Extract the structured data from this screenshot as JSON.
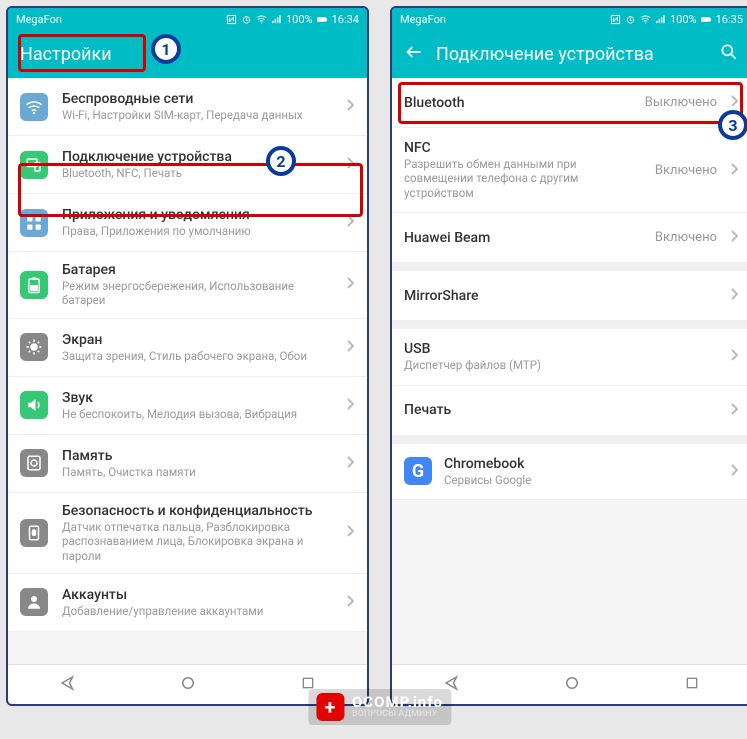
{
  "status": {
    "carrier": "MegaFon",
    "battery": "100%",
    "time1": "16:34",
    "time2": "16:35"
  },
  "left": {
    "title": "Настройки",
    "items": [
      {
        "title": "Беспроводные сети",
        "sub": "Wi-Fi, Настройки SIM-карт, Передача данных",
        "icon": "wifi",
        "col": "#6aa9d4"
      },
      {
        "title": "Подключение устройства",
        "sub": "Bluetooth, NFC, Печать",
        "icon": "devcon",
        "col": "#37c876"
      },
      {
        "title": "Приложения и уведомления",
        "sub": "Права, Приложения по умолчанию",
        "icon": "apps",
        "col": "#6aa9d4"
      },
      {
        "title": "Батарея",
        "sub": "Режим энергосбережения, Использование батареи",
        "icon": "battery",
        "col": "#37c876"
      },
      {
        "title": "Экран",
        "sub": "Защита зрения, Стиль рабочего экрана, Обои",
        "icon": "display",
        "col": "#888"
      },
      {
        "title": "Звук",
        "sub": "Не беспокоить, Мелодия вызова, Вибрация",
        "icon": "sound",
        "col": "#37c876"
      },
      {
        "title": "Память",
        "sub": "Память, Очистка памяти",
        "icon": "storage",
        "col": "#888"
      },
      {
        "title": "Безопасность и конфиденциальность",
        "sub": "Датчик отпечатка пальца, Разблокировка распознаванием лица, Блокировка экрана и пароли",
        "icon": "security",
        "col": "#888"
      },
      {
        "title": "Аккаунты",
        "sub": "Добавление/управление аккаунтами",
        "icon": "accounts",
        "col": "#888"
      }
    ]
  },
  "right": {
    "title": "Подключение устройства",
    "items": [
      {
        "title": "Bluetooth",
        "sub": "",
        "val": "Выключено"
      },
      {
        "title": "NFC",
        "sub": "Разрешить обмен данными при совмещении телефона с другим устройством",
        "val": "Включено"
      },
      {
        "title": "Huawei Beam",
        "sub": "",
        "val": "Включено"
      },
      {
        "title": "MirrorShare",
        "sub": "",
        "val": ""
      },
      {
        "title": "USB",
        "sub": "Диспетчер файлов (MTP)",
        "val": ""
      },
      {
        "title": "Печать",
        "sub": "",
        "val": ""
      },
      {
        "title": "Chromebook",
        "sub": "Сервисы Google",
        "val": "",
        "icon": "g"
      }
    ]
  },
  "watermark": {
    "main": "OCOMP.info",
    "sub": "ВОПРОСЫ АДМИНУ"
  }
}
